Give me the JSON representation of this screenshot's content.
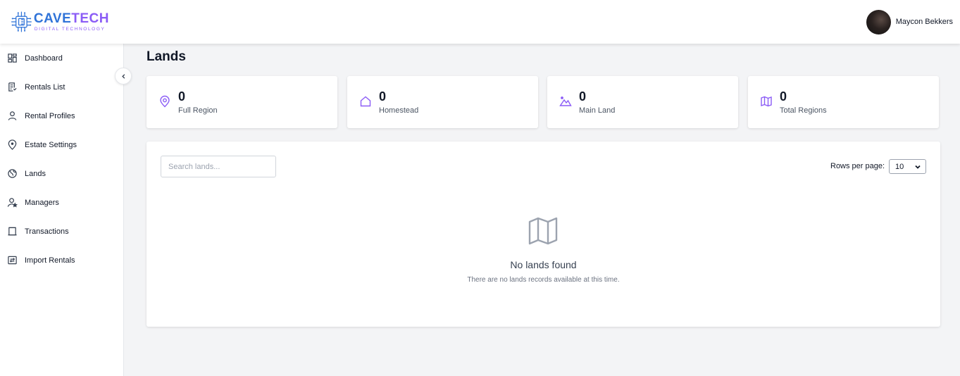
{
  "brand": {
    "name": "CAVETECH",
    "tagline": "DIGITAL TECHNOLOGY",
    "icon": "circuit-chip-logo",
    "colors": {
      "primary": "#2f73d8",
      "accent": "#8b5cf6"
    }
  },
  "user": {
    "name": "Maycon Bekkers",
    "avatar": "user-avatar-photo"
  },
  "sidebar": {
    "items": [
      {
        "label": "Dashboard",
        "icon": "dashboard-icon"
      },
      {
        "label": "Rentals List",
        "icon": "rentals-list-icon"
      },
      {
        "label": "Rental Profiles",
        "icon": "user-icon"
      },
      {
        "label": "Estate Settings",
        "icon": "map-pin-icon"
      },
      {
        "label": "Lands",
        "icon": "globe-icon"
      },
      {
        "label": "Managers",
        "icon": "user-star-icon"
      },
      {
        "label": "Transactions",
        "icon": "receipt-icon"
      },
      {
        "label": "Import Rentals",
        "icon": "import-icon"
      }
    ],
    "collapse_icon": "chevron-left-icon"
  },
  "page": {
    "title": "Lands"
  },
  "stats": [
    {
      "value": "0",
      "label": "Full Region",
      "icon": "map-pin-icon"
    },
    {
      "value": "0",
      "label": "Homestead",
      "icon": "home-icon"
    },
    {
      "value": "0",
      "label": "Main Land",
      "icon": "mountain-icon"
    },
    {
      "value": "0",
      "label": "Total Regions",
      "icon": "map-icon"
    }
  ],
  "table": {
    "search_placeholder": "Search lands...",
    "rows_per_page_label": "Rows per page:",
    "rows_per_page_value": "10",
    "empty_title": "No lands found",
    "empty_subtitle": "There are no lands records available at this time.",
    "empty_icon": "map-icon"
  },
  "colors": {
    "accent_icon": "#8b5cf6",
    "empty_icon": "#9ca3af",
    "background": "#f3f4f6"
  }
}
